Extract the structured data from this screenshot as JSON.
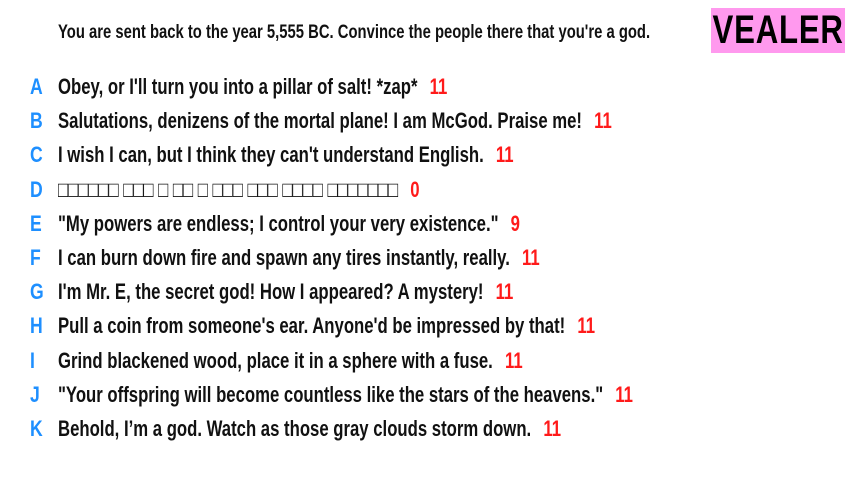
{
  "prompt": "You are sent back to the year 5,555 BC. Convince the people there that you're a god.",
  "logo": "VEALER",
  "colors": {
    "letter": "#1e8fff",
    "score": "#ff1a1a",
    "logo_bg": "#ff99ee"
  },
  "answers": [
    {
      "letter": "A",
      "text": "Obey, or I'll turn you into a pillar of salt! *zap*",
      "score": "11"
    },
    {
      "letter": "B",
      "text": "Salutations, denizens of the mortal plane! I am McGod. Praise me!",
      "score": "11"
    },
    {
      "letter": "C",
      "text": "I wish I can, but I think they can't understand English.",
      "score": "11"
    },
    {
      "letter": "D",
      "text": "□□□□□□ □□□ □ □□ □ □□□ □□□ □□□□ □□□□□□□",
      "score": "0"
    },
    {
      "letter": "E",
      "text": "\"My powers are endless; I control your very existence.\"",
      "score": "9"
    },
    {
      "letter": "F",
      "text": "I can burn down fire and spawn any tires instantly, really.",
      "score": "11"
    },
    {
      "letter": "G",
      "text": "I'm Mr. E, the secret god! How I appeared? A mystery!",
      "score": "11"
    },
    {
      "letter": "H",
      "text": "Pull a coin from someone's ear. Anyone'd be impressed by that!",
      "score": "11"
    },
    {
      "letter": "I",
      "text": "Grind blackened wood, place it in a sphere with a fuse.",
      "score": "11"
    },
    {
      "letter": "J",
      "text": "\"Your offspring will become countless like the stars of the heavens.\"",
      "score": "11"
    },
    {
      "letter": "K",
      "text": "Behold, I’m a god. Watch as those gray clouds storm down.",
      "score": "11"
    }
  ]
}
